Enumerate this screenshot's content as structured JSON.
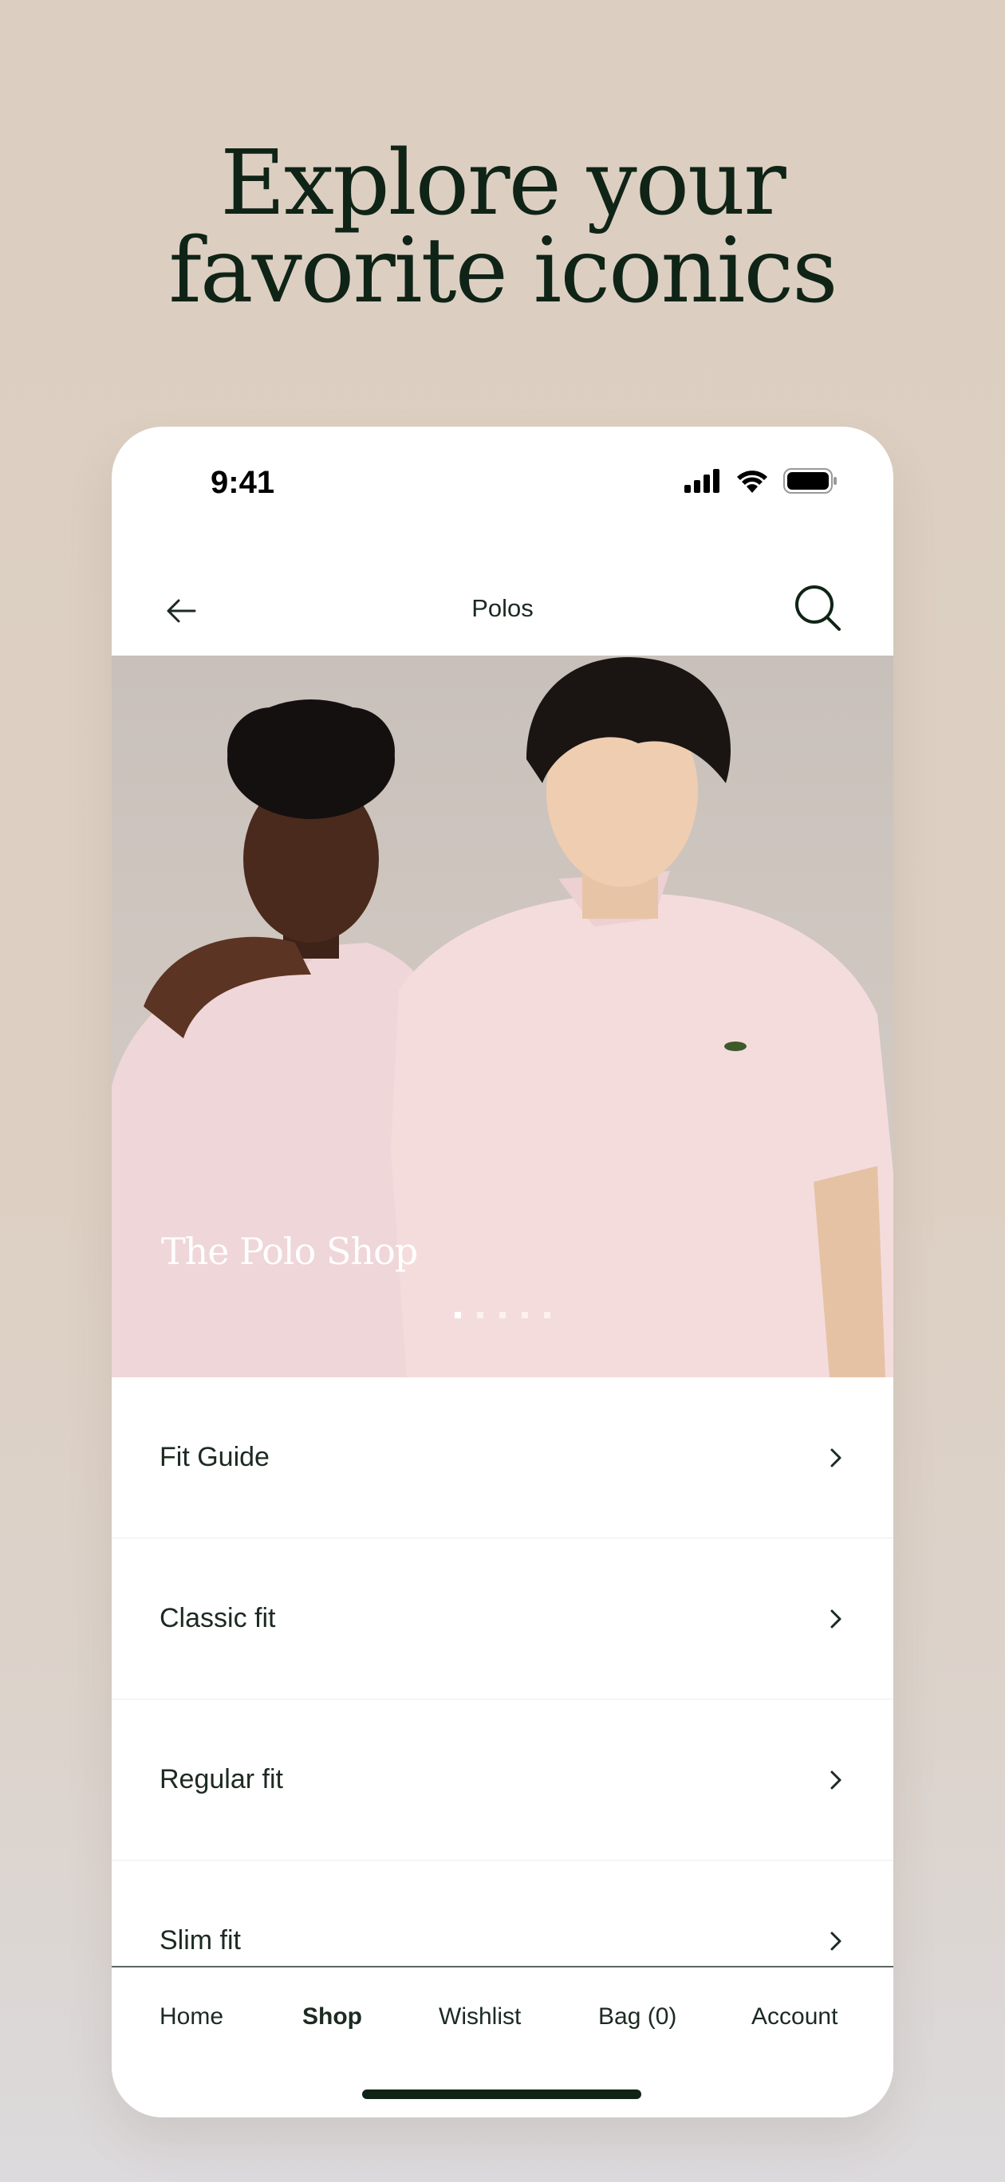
{
  "headline": {
    "line1": "Explore your",
    "line2": "favorite iconics"
  },
  "status_bar": {
    "time": "9:41"
  },
  "navbar": {
    "title": "Polos"
  },
  "hero": {
    "title": "The Polo Shop",
    "slides_total": 5,
    "active_slide": 1
  },
  "menu": [
    {
      "label": "Fit Guide"
    },
    {
      "label": "Classic fit"
    },
    {
      "label": "Regular fit"
    },
    {
      "label": "Slim fit"
    }
  ],
  "tabbar": {
    "items": [
      {
        "label": "Home",
        "active": false
      },
      {
        "label": "Shop",
        "active": true
      },
      {
        "label": "Wishlist",
        "active": false
      },
      {
        "label": "Bag (0)",
        "active": false
      },
      {
        "label": "Account",
        "active": false
      }
    ]
  },
  "colors": {
    "brand_green": "#0f2416",
    "background": "#dccfc1",
    "polo_pink": "#f1d9db"
  },
  "icons": [
    "back-arrow-icon",
    "search-icon",
    "chevron-right-icon",
    "signal-icon",
    "wifi-icon",
    "battery-icon",
    "crocodile-logo-icon"
  ]
}
